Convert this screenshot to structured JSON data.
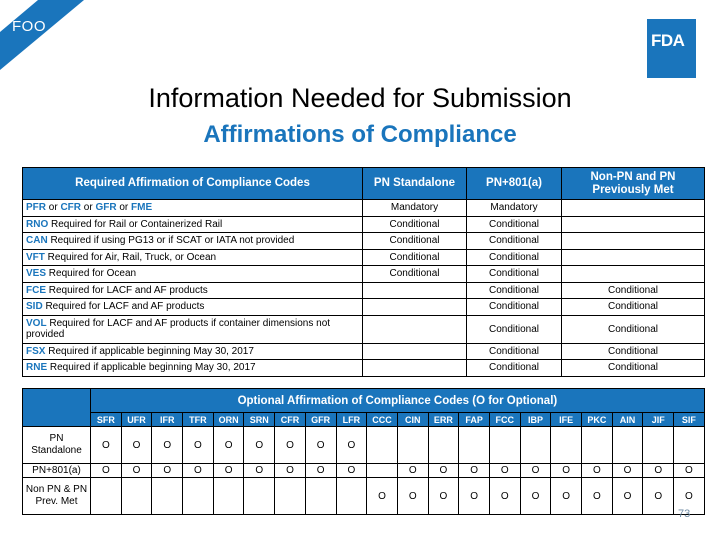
{
  "banner": {
    "label": "FOO",
    "color": "#1a75bc"
  },
  "logo": {
    "text": "FDA",
    "color": "#1a75bc"
  },
  "title": "Information Needed for Submission",
  "subtitle": "Affirmations of Compliance",
  "required_table": {
    "headers": [
      "Required  Affirmation of Compliance Codes",
      "PN Standalone",
      "PN+801(a)",
      "Non-PN and PN Previously Met"
    ],
    "rows": [
      {
        "codes": [
          "PFR",
          "CFR",
          "GFR",
          "FME"
        ],
        "joiner": " or ",
        "desc": "",
        "pn_standalone": "Mandatory",
        "pn_801a": "Mandatory",
        "non_pn": ""
      },
      {
        "code": "RNO",
        "desc": " Required for Rail or Containerized Rail",
        "pn_standalone": "Conditional",
        "pn_801a": "Conditional",
        "non_pn": ""
      },
      {
        "code": "CAN",
        "desc": " Required if using PG13 or if SCAT or IATA not provided",
        "pn_standalone": "Conditional",
        "pn_801a": "Conditional",
        "non_pn": ""
      },
      {
        "code": "VFT",
        "desc": " Required for Air, Rail, Truck, or Ocean",
        "pn_standalone": "Conditional",
        "pn_801a": "Conditional",
        "non_pn": ""
      },
      {
        "code": "VES",
        "desc": " Required for Ocean",
        "pn_standalone": "Conditional",
        "pn_801a": "Conditional",
        "non_pn": ""
      },
      {
        "code": "FCE",
        "desc": " Required for LACF and AF products",
        "pn_standalone": "",
        "pn_801a": "Conditional",
        "non_pn": "Conditional"
      },
      {
        "code": "SID",
        "desc": " Required for LACF and AF products",
        "pn_standalone": "",
        "pn_801a": "Conditional",
        "non_pn": "Conditional"
      },
      {
        "code": "VOL",
        "desc": " Required for LACF and AF products if container dimensions not provided",
        "pn_standalone": "",
        "pn_801a": "Conditional",
        "non_pn": "Conditional"
      },
      {
        "code": "FSX",
        "desc": " Required if applicable beginning May 30, 2017",
        "pn_standalone": "",
        "pn_801a": "Conditional",
        "non_pn": "Conditional"
      },
      {
        "code": "RNE",
        "desc": " Required if applicable beginning May 30, 2017",
        "pn_standalone": "",
        "pn_801a": "Conditional",
        "non_pn": "Conditional"
      }
    ]
  },
  "optional_table": {
    "title": "Optional Affirmation of Compliance Codes  (O for Optional)",
    "codes": [
      "SFR",
      "UFR",
      "IFR",
      "TFR",
      "ORN",
      "SRN",
      "CFR",
      "GFR",
      "LFR",
      "CCC",
      "CIN",
      "ERR",
      "FAP",
      "FCC",
      "IBP",
      "IFE",
      "PKC",
      "AIN",
      "JIF",
      "SIF"
    ],
    "rows": [
      {
        "label": "PN Standalone",
        "marks": [
          "O",
          "O",
          "O",
          "O",
          "O",
          "O",
          "O",
          "O",
          "O",
          "",
          "",
          "",
          "",
          "",
          "",
          "",
          "",
          "",
          "",
          ""
        ]
      },
      {
        "label": "PN+801(a)",
        "marks": [
          "O",
          "O",
          "O",
          "O",
          "O",
          "O",
          "O",
          "O",
          "O",
          "",
          "O",
          "O",
          "O",
          "O",
          "O",
          "O",
          "O",
          "O",
          "O",
          "O"
        ]
      },
      {
        "label": "Non PN & PN Prev. Met",
        "marks": [
          "",
          "",
          "",
          "",
          "",
          "",
          "",
          "",
          "",
          "O",
          "O",
          "O",
          "O",
          "O",
          "O",
          "O",
          "O",
          "O",
          "O",
          "O"
        ]
      }
    ]
  },
  "page_number": "73"
}
